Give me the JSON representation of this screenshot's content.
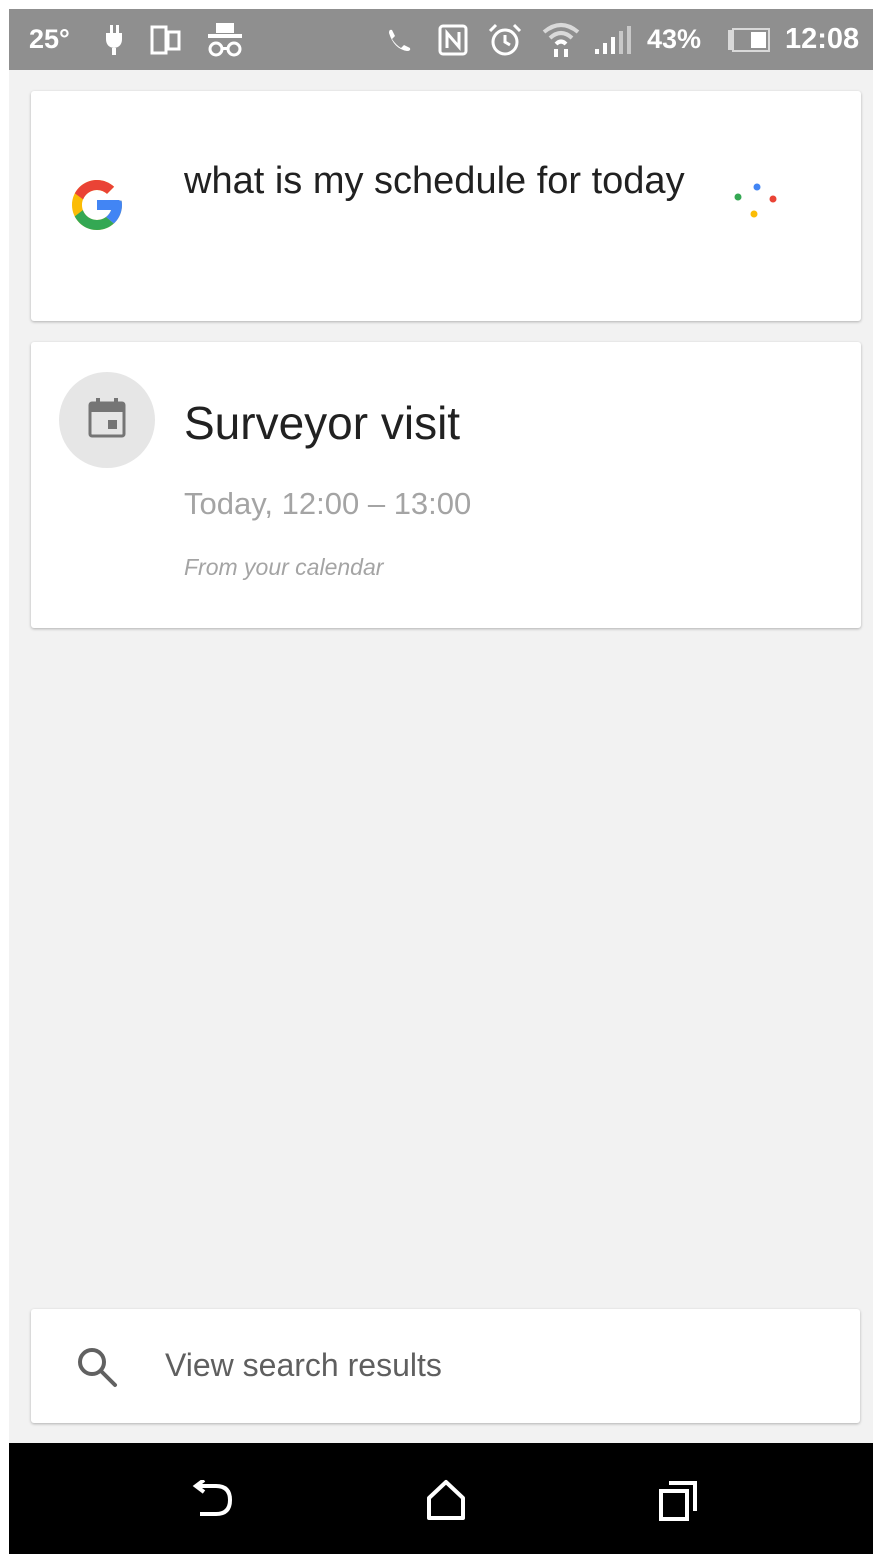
{
  "status_bar": {
    "temperature": "25°",
    "battery_percent": "43%",
    "time": "12:08",
    "icons": [
      "power-plug-icon",
      "dual-screen-icon",
      "incognito-icon",
      "phone-call-icon",
      "nfc-icon",
      "alarm-icon",
      "wifi-icon",
      "signal-icon",
      "battery-icon"
    ]
  },
  "query_card": {
    "logo": "google-g-icon",
    "query": "what is my schedule for today",
    "voice_indicator": "assistant-dots-icon"
  },
  "event_card": {
    "icon": "calendar-icon",
    "title": "Surveyor visit",
    "time": "Today, 12:00 – 13:00",
    "source": "From your calendar"
  },
  "results_card": {
    "icon": "search-icon",
    "label": "View search results"
  },
  "nav_bar": {
    "icons": [
      "back-icon",
      "home-icon",
      "recents-icon"
    ]
  },
  "colors": {
    "status_bar_bg": "#8f8f8f",
    "screen_bg": "#f2f2f2",
    "card_bg": "#ffffff",
    "google_blue": "#4285F4",
    "google_red": "#EA4335",
    "google_yellow": "#FBBC05",
    "google_green": "#34A853",
    "nav_bar_bg": "#000000"
  }
}
